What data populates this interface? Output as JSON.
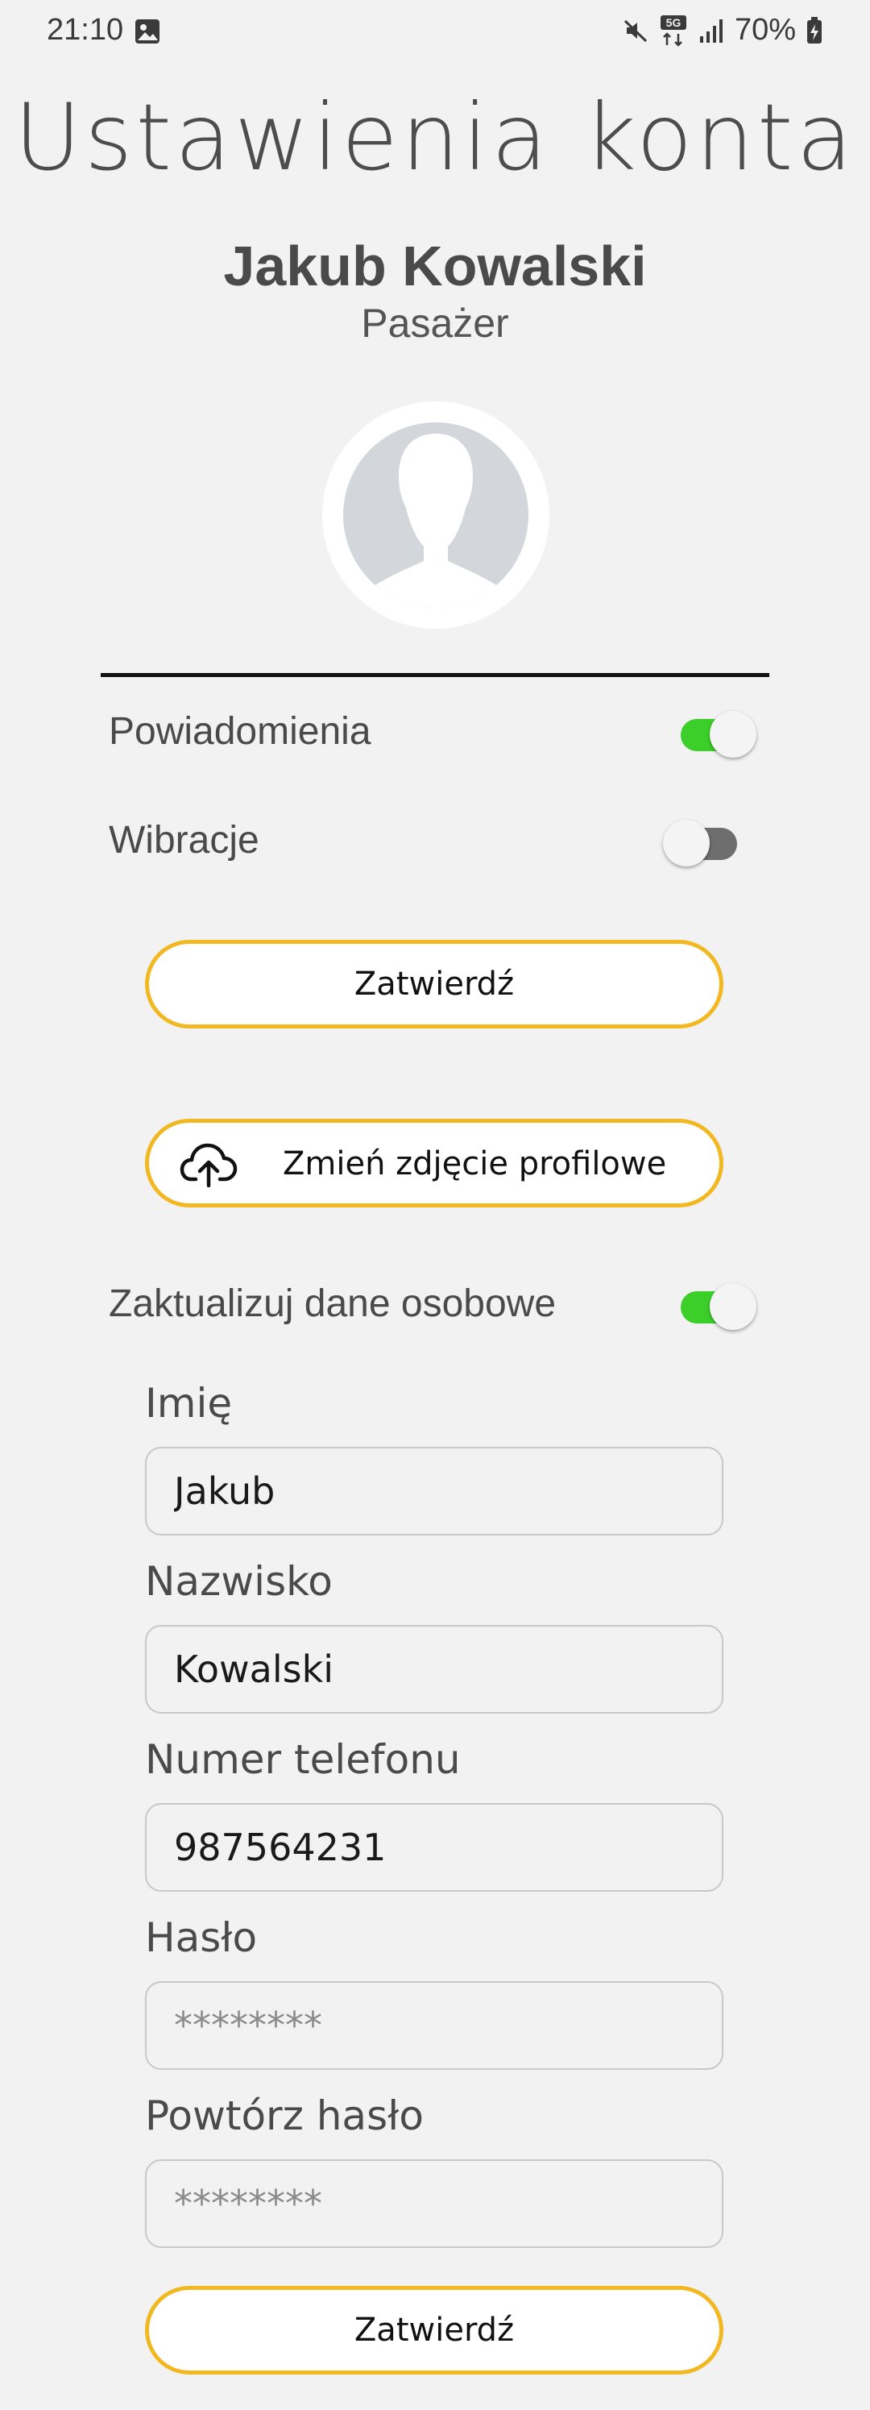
{
  "status_bar": {
    "time": "21:10",
    "battery": "70%",
    "network": "5G"
  },
  "page": {
    "title": "Ustawienia konta"
  },
  "profile": {
    "name": "Jakub Kowalski",
    "role": "Pasażer"
  },
  "settings": {
    "notifications_label": "Powiadomienia",
    "notifications_on": true,
    "vibrations_label": "Wibracje",
    "vibrations_on": false,
    "confirm_label": "Zatwierdź"
  },
  "change_photo": {
    "label": "Zmień zdjęcie profilowe"
  },
  "personal_data": {
    "toggle_label": "Zaktualizuj dane osobowe",
    "toggle_on": true,
    "first_name_label": "Imię",
    "first_name_value": "Jakub",
    "last_name_label": "Nazwisko",
    "last_name_value": "Kowalski",
    "phone_label": "Numer telefonu",
    "phone_value": "987564231",
    "password_label": "Hasło",
    "password_placeholder": "********",
    "repeat_password_label": "Powtórz hasło",
    "repeat_password_placeholder": "********",
    "confirm_label": "Zatwierdź"
  },
  "colors": {
    "background": "#f2f2f2",
    "accent_border": "#f2b822",
    "switch_on": "#3ccf2a",
    "switch_off": "#6e6e6e"
  }
}
